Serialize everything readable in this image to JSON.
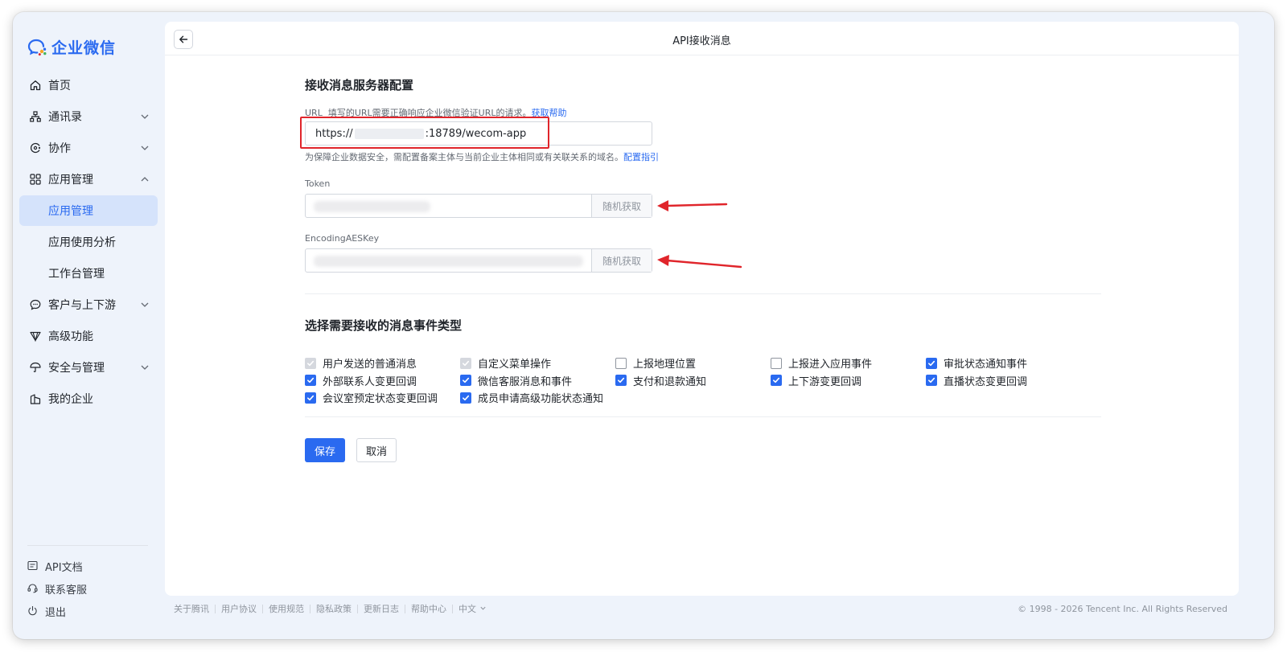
{
  "brand": {
    "name": "企业微信"
  },
  "sidebar": {
    "items": [
      {
        "label": "首页",
        "icon": "home-icon"
      },
      {
        "label": "通讯录",
        "icon": "org-icon",
        "expandable": true
      },
      {
        "label": "协作",
        "icon": "collab-icon",
        "expandable": true
      },
      {
        "label": "应用管理",
        "icon": "grid-icon",
        "expandable": true,
        "expanded": true
      },
      {
        "label": "应用管理",
        "sub": true,
        "active": true
      },
      {
        "label": "应用使用分析",
        "sub": true
      },
      {
        "label": "工作台管理",
        "sub": true
      },
      {
        "label": "客户与上下游",
        "icon": "chat-icon",
        "expandable": true
      },
      {
        "label": "高级功能",
        "icon": "diamond-icon"
      },
      {
        "label": "安全与管理",
        "icon": "umbrella-icon",
        "expandable": true
      },
      {
        "label": "我的企业",
        "icon": "building-icon"
      }
    ],
    "bottom": [
      {
        "label": "API文档",
        "icon": "doc-icon"
      },
      {
        "label": "联系客服",
        "icon": "headset-icon"
      },
      {
        "label": "退出",
        "icon": "power-icon"
      }
    ]
  },
  "header": {
    "title": "API接收消息"
  },
  "server_config": {
    "title": "接收消息服务器配置",
    "url_label": "URL",
    "url_desc": "填写的URL需要正确响应企业微信验证URL的请求。",
    "url_help_link": "获取帮助",
    "url_value_prefix": "https://",
    "url_value_suffix": ":18789/wecom-app",
    "url_hint": "为保障企业数据安全，需配置备案主体与当前企业主体相同或有关联关系的域名。",
    "url_hint_link": "配置指引",
    "token_label": "Token",
    "token_button": "随机获取",
    "aes_label": "EncodingAESKey",
    "aes_button": "随机获取"
  },
  "events": {
    "title": "选择需要接收的消息事件类型",
    "items": [
      {
        "label": "用户发送的普通消息",
        "state": "disabled"
      },
      {
        "label": "自定义菜单操作",
        "state": "disabled"
      },
      {
        "label": "上报地理位置",
        "state": "unchecked"
      },
      {
        "label": "上报进入应用事件",
        "state": "unchecked"
      },
      {
        "label": "审批状态通知事件",
        "state": "checked"
      },
      {
        "label": "外部联系人变更回调",
        "state": "checked"
      },
      {
        "label": "微信客服消息和事件",
        "state": "checked"
      },
      {
        "label": "支付和退款通知",
        "state": "checked"
      },
      {
        "label": "上下游变更回调",
        "state": "checked"
      },
      {
        "label": "直播状态变更回调",
        "state": "checked"
      },
      {
        "label": "会议室预定状态变更回调",
        "state": "checked"
      },
      {
        "label": "成员申请高级功能状态通知",
        "state": "checked"
      }
    ]
  },
  "actions": {
    "save": "保存",
    "cancel": "取消"
  },
  "footer": {
    "links": [
      "关于腾讯",
      "用户协议",
      "使用规范",
      "隐私政策",
      "更新日志",
      "帮助中心",
      "中文"
    ],
    "copyright": "© 1998 - 2026 Tencent Inc. All Rights Reserved"
  },
  "colors": {
    "accent": "#2a6af0",
    "highlight": "#e0252b"
  }
}
